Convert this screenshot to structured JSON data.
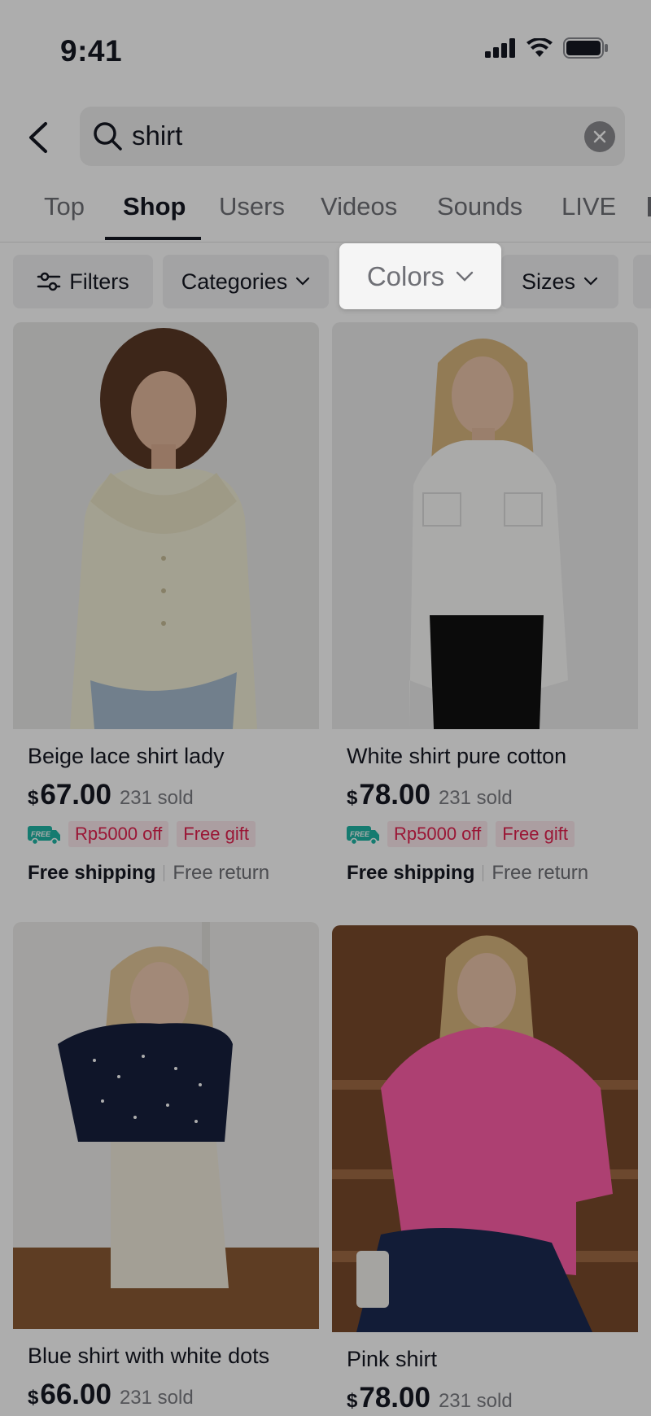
{
  "status_bar": {
    "time": "9:41"
  },
  "search": {
    "query": "shirt"
  },
  "tabs": [
    {
      "label": "Top",
      "active": false
    },
    {
      "label": "Shop",
      "active": true
    },
    {
      "label": "Users",
      "active": false
    },
    {
      "label": "Videos",
      "active": false
    },
    {
      "label": "Sounds",
      "active": false
    },
    {
      "label": "LIVE",
      "active": false
    }
  ],
  "filters": {
    "filters_label": "Filters",
    "categories_label": "Categories",
    "colors_label": "Colors",
    "sizes_label": "Sizes"
  },
  "products": [
    {
      "title": "Beige lace shirt lady",
      "currency": "$",
      "price": "67.00",
      "sold": "231 sold",
      "promo_discount": "Rp5000 off",
      "promo_gift": "Free gift",
      "free_badge": "FREE",
      "shipping": "Free shipping",
      "return": "Free return"
    },
    {
      "title": "White shirt pure cotton",
      "currency": "$",
      "price": "78.00",
      "sold": "231 sold",
      "promo_discount": "Rp5000 off",
      "promo_gift": "Free gift",
      "free_badge": "FREE",
      "shipping": "Free shipping",
      "return": "Free return"
    },
    {
      "title": "Blue shirt with white dots",
      "currency": "$",
      "price": "66.00",
      "sold": "231 sold"
    },
    {
      "title": "Pink shirt",
      "currency": "$",
      "price": "78.00",
      "sold": "231 sold"
    }
  ],
  "colors": {
    "accent_red": "#e3214f",
    "badge_teal": "#1fb6a6",
    "overlay": "rgba(0,0,0,0.32)"
  }
}
